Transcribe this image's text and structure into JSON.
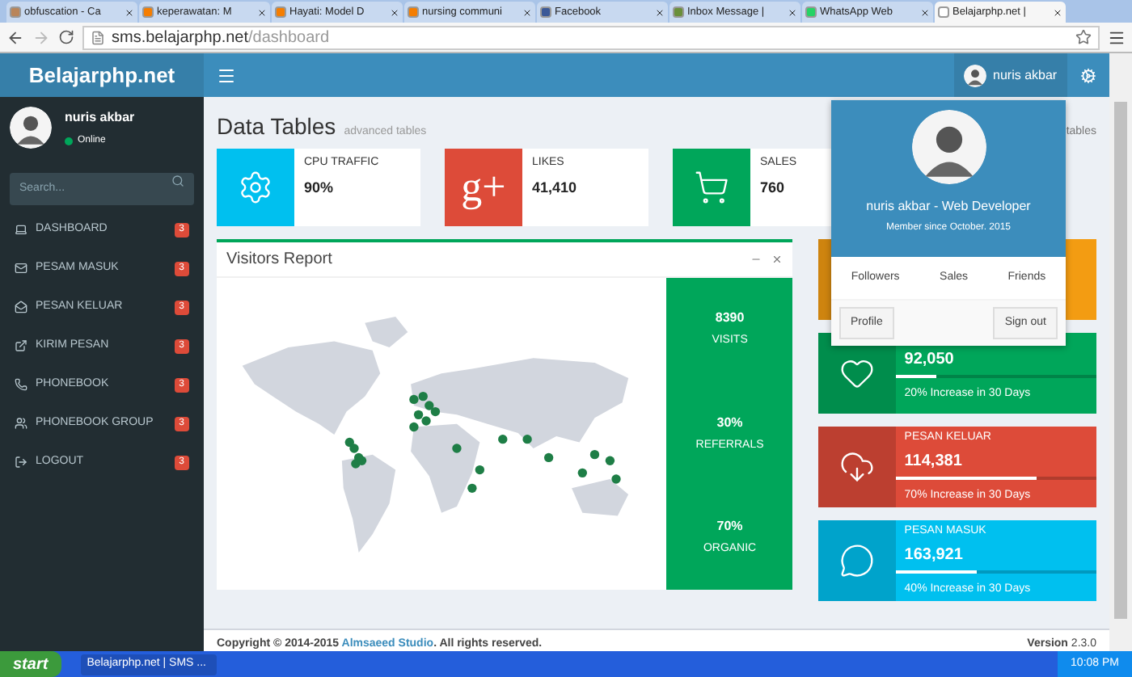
{
  "browser": {
    "tabs": [
      {
        "label": "obfuscation - Ca",
        "kind": "generic",
        "selected": false
      },
      {
        "label": "keperawatan: M",
        "kind": "blogger",
        "selected": false
      },
      {
        "label": "Hayati: Model D",
        "kind": "blogger",
        "selected": false
      },
      {
        "label": "nursing communi",
        "kind": "blogger",
        "selected": false
      },
      {
        "label": "Facebook",
        "kind": "facebook",
        "selected": false
      },
      {
        "label": "Inbox Message |",
        "kind": "inbox",
        "selected": false
      },
      {
        "label": "WhatsApp Web",
        "kind": "whatsapp",
        "selected": false
      },
      {
        "label": "Belajarphp.net |",
        "kind": "page",
        "selected": true
      }
    ],
    "url_host": "sms.belajarphp.net",
    "url_path": "/dashboard"
  },
  "header": {
    "logo": "Belajarphp.net",
    "user_name": "nuris akbar"
  },
  "sidebar": {
    "user": {
      "name": "nuris akbar",
      "status": "Online"
    },
    "search": {
      "placeholder": "Search..."
    },
    "items": [
      {
        "label": "DASHBOARD",
        "kind": "laptop",
        "badge": "3"
      },
      {
        "label": "PESAM MASUK",
        "kind": "envelope",
        "badge": "3"
      },
      {
        "label": "PESAN KELUAR",
        "kind": "outbox",
        "badge": "3"
      },
      {
        "label": "KIRIM PESAN",
        "kind": "send",
        "badge": "3"
      },
      {
        "label": "PHONEBOOK",
        "kind": "phone",
        "badge": "3"
      },
      {
        "label": "PHONEBOOK GROUP",
        "kind": "group",
        "badge": "3"
      },
      {
        "label": "LOGOUT",
        "kind": "logout",
        "badge": "3"
      }
    ]
  },
  "page": {
    "title": "Data Tables",
    "subtitle": "advanced tables",
    "breadcrumb": "tables"
  },
  "info_boxes": [
    {
      "label": "CPU TRAFFIC",
      "value": "90%",
      "kind": "gear",
      "color": "#00c0ef"
    },
    {
      "label": "LIKES",
      "value": "41,410",
      "kind": "gplus",
      "icon_text": "g+",
      "color": "#dd4b39"
    },
    {
      "label": "SALES",
      "value": "760",
      "kind": "cart",
      "color": "#00a65a"
    }
  ],
  "visitors": {
    "title": "Visitors Report",
    "stats": [
      {
        "value": "8390",
        "label": "VISITS"
      },
      {
        "value": "30%",
        "label": "REFERRALS"
      },
      {
        "value": "70%",
        "label": "ORGANIC"
      }
    ]
  },
  "progress_boxes": [
    {
      "kind": "covered",
      "color": "#f39c12"
    },
    {
      "kind": "heart",
      "color": "#00a65a",
      "value": "92,050",
      "level": 0.2,
      "caption": "20% Increase in 30 Days"
    },
    {
      "kind": "cloud",
      "color": "#dd4b39",
      "label": "PESAN KELUAR",
      "value": "114,381",
      "level": 0.7,
      "caption": "70% Increase in 30 Days"
    },
    {
      "kind": "comment",
      "color": "#00c0ef",
      "label": "PESAN MASUK",
      "value": "163,921",
      "level": 0.4,
      "caption": "40% Increase in 30 Days"
    }
  ],
  "dropdown": {
    "name_line": "nuris akbar - Web Developer",
    "member_since": "Member since October. 2015",
    "links": [
      "Followers",
      "Sales",
      "Friends"
    ],
    "buttons": [
      "Profile",
      "Sign out"
    ]
  },
  "footer": {
    "copyright": "Copyright © 2014-2015",
    "link": "Almsaeed Studio",
    "rights": ". All rights reserved.",
    "version_label": "Version",
    "version": "2.3.0"
  },
  "taskbar": {
    "start": "start",
    "windows": [
      {
        "label": "Belajarphp.net | SMS ...",
        "selected": true
      }
    ],
    "time": "10:08 PM"
  }
}
